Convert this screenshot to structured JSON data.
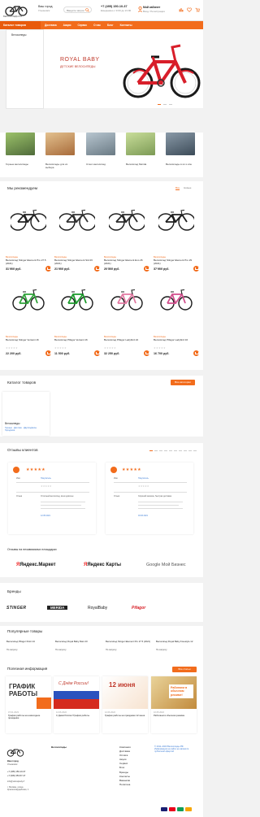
{
  "header": {
    "logo_text": "ВЕЛОСИПЕДЫ.РФ",
    "city": "Ваш город",
    "city_name": "Ульяновск",
    "search_placeholder": "Введите запрос",
    "phone": "+7 (495) 150-10-37",
    "phone_hours": "Ежедневно с 9:00 до 21:00",
    "account_title": "Мой кабинет",
    "account_sub": "Вход / Регистрация"
  },
  "nav": {
    "catalog_label": "Каталог товаров",
    "items": [
      "Доставка",
      "Акции",
      "Сервис",
      "О нас",
      "Блог",
      "Контакты"
    ]
  },
  "catalog_menu": {
    "item": "Велосипеды"
  },
  "hero": {
    "brand": "ROYAL BABY",
    "subtitle": "ДЕТСКИЕ ВЕЛОСИПЕДЫ"
  },
  "categories": [
    {
      "label": "Горные велосипеды",
      "color": "#4f6b3a"
    },
    {
      "label": "Велосипеды для их выбора",
      "color": "#a86b3a"
    },
    {
      "label": "Стант-велосипед",
      "color": "#6a7a84"
    },
    {
      "label": "Велосипед Merida",
      "color": "#7c9a55"
    },
    {
      "label": "Велосипеды в их и ипе",
      "color": "#3c4b58"
    }
  ],
  "recommend": {
    "title": "Мы рекомендуем",
    "tab_active": "Все",
    "tab_other": "Новые",
    "products": [
      {
        "brand": "Велосипеды",
        "name": "Велосипед Stinger Element Pro 27.5 (2021)",
        "price": "31 900 руб.",
        "frame": "#222222"
      },
      {
        "brand": "Велосипеды",
        "name": "Велосипед Stinger Element Std 26 (2021)",
        "price": "21 900 руб.",
        "frame": "#333333"
      },
      {
        "brand": "Велосипеды",
        "name": "Велосипед Stinger Element Evo 26 (2021)",
        "price": "20 500 руб.",
        "frame": "#2b2b2b"
      },
      {
        "brand": "Велосипеды",
        "name": "Велосипед Stinger Element Pro 29 (2021)",
        "price": "37 900 руб.",
        "frame": "#1e1e1e"
      },
      {
        "brand": "Велосипеды",
        "name": "Велосипед Stinger Versant 16",
        "price": "22 200 руб.",
        "frame": "#2fa33a"
      },
      {
        "brand": "Велосипеды",
        "name": "Велосипед Pifagor Versant 16",
        "price": "11 500 руб.",
        "frame": "#1b9a2b"
      },
      {
        "brand": "Велосипеды",
        "name": "Велосипед Pifagor Ladybird 24",
        "price": "32 250 руб.",
        "frame": "#e27aa2"
      },
      {
        "brand": "Велосипеды",
        "name": "Велосипед Pifagor Ladybird 16",
        "price": "16 700 руб.",
        "frame": "#d24f8d"
      }
    ]
  },
  "catalog": {
    "title": "Каталог товаров",
    "button": "Все категории",
    "card_title": "Велосипеды",
    "card_links": [
      "Горные",
      "Детские",
      "Двухподвесы",
      "Городские"
    ]
  },
  "reviews": {
    "title": "Отзывы клиентов",
    "card1": {
      "name": "Покупатель",
      "text": "Отличный велосипед, всем доволен",
      "date": "12.05.2021"
    },
    "card2": {
      "name": "Покупатель",
      "text": "Хороший магазин, быстрая доставка",
      "date": "03.06.2021"
    }
  },
  "other_platforms": {
    "title": "Отзывы на независимых площадках",
    "logos": [
      "Яндекс.Маркет",
      "Яндекс Карты",
      "Google Мой Бизнес"
    ]
  },
  "brands": {
    "title": "Бренды",
    "items": [
      "STINGER",
      "MERIDA",
      "RoyalBaby",
      "Pifagor"
    ]
  },
  "popular": {
    "title": "Популярные товары",
    "items": [
      {
        "name": "Велосипед Pifagor Point 24",
        "price": "По запросу"
      },
      {
        "name": "Велосипед Royal Baby Rain 20",
        "price": "По запросу"
      },
      {
        "name": "Велосипед Stinger Element Pro 27.5 (2021)",
        "price": "По запросу"
      },
      {
        "name": "Велосипед Royal Baby Freestyle 12",
        "price": "По запросу"
      }
    ]
  },
  "useful": {
    "title": "Полезная информация",
    "button": "Все статьи",
    "cards": [
      {
        "image_text": "ГРАФИК РАБОТЫ",
        "date": "07.01.2023",
        "label": "График работы на новогодние праздники"
      },
      {
        "image_text": "С Днём России!",
        "date": "12.06.2022",
        "label": "С Днём России! График работы"
      },
      {
        "image_text": "12 июня",
        "date": "12.06.2022",
        "label": "График работы на праздники 12 июня"
      },
      {
        "image_text": "Работаем в обычном режиме!",
        "date": "10.05.2022",
        "label": "Работаем в обычном режиме"
      }
    ]
  },
  "footer": {
    "col1_title": "Велосипеды",
    "col2": [
      "Компания",
      "Доставка",
      "Оплата",
      "Акции",
      "Сервис",
      "Блог",
      "Бренды",
      "Контакты",
      "Вакансии",
      "Политика"
    ],
    "contacts_city": "Ваш город",
    "contacts_city_name": "Ульяновск",
    "phone1": "+7 (495) 150-10-37",
    "phone2": "+7 (909) 353-57-47",
    "email": "info@velosipedy.rf",
    "address": "г. Москва, улица Красногвардейская, 1",
    "rights": "© 2011–2023 Велосипеды.РФ. Информация на сайте не является публичной офертой",
    "pay_colors": [
      "#1a1f71",
      "#eb001b",
      "#0f9d58",
      "#f7a600"
    ]
  },
  "colors": {
    "accent": "#f26c1c",
    "link": "#3a7bd5"
  }
}
